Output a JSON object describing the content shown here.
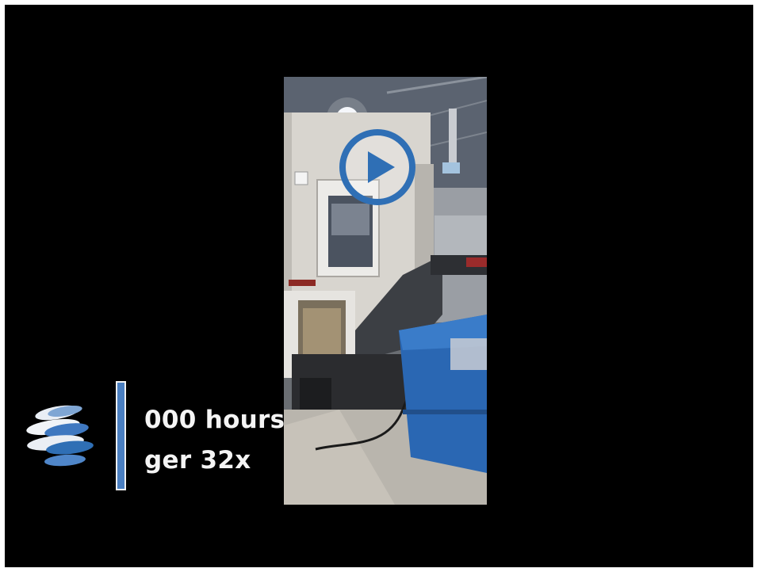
{
  "video": {
    "overlay_line1": "000 hours",
    "overlay_line2": "ger 32x"
  },
  "icons": {
    "play": "play-icon",
    "logo": "globe-logo-icon"
  },
  "colors": {
    "background": "#000000",
    "play_ring": "#2f6fb5",
    "accent_bar": "#4a7fc1",
    "bin_blue": "#2a67b3"
  }
}
